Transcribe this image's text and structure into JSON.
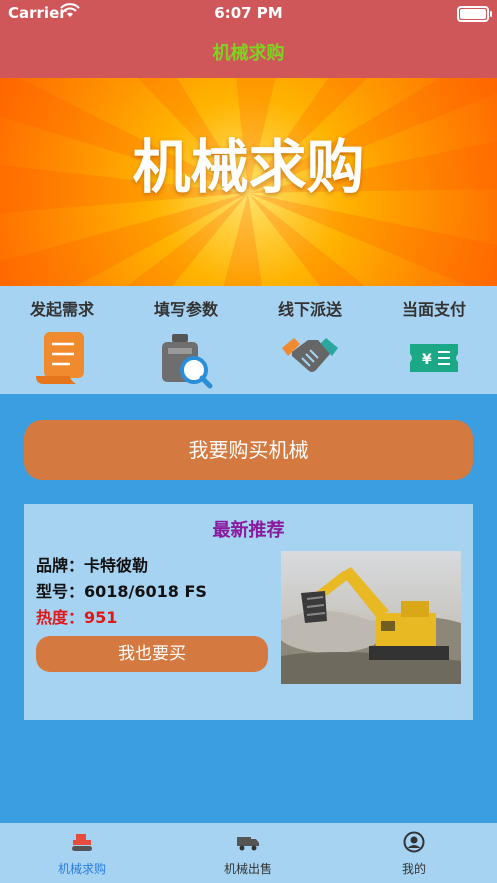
{
  "status_bar": {
    "carrier": "Carrier",
    "time": "6:07 PM"
  },
  "navbar": {
    "title": "机械求购"
  },
  "banner": {
    "title": "机械求购"
  },
  "features": [
    {
      "label": "发起需求",
      "icon": "scroll-document-icon"
    },
    {
      "label": "填写参数",
      "icon": "search-parameter-icon"
    },
    {
      "label": "线下派送",
      "icon": "handshake-icon"
    },
    {
      "label": "当面支付",
      "icon": "yuan-ticket-icon"
    }
  ],
  "buy_button": {
    "label": "我要购买机械"
  },
  "recommend": {
    "title": "最新推荐",
    "brand": "品牌：卡特彼勒",
    "model": "型号：6018/6018 FS",
    "hot": "热度：951",
    "button": "我也要买",
    "image": "excavator-photo"
  },
  "tabbar": [
    {
      "label": "机械求购",
      "icon": "crawler-machine-icon",
      "active": true
    },
    {
      "label": "机械出售",
      "icon": "truck-icon",
      "active": false
    },
    {
      "label": "我的",
      "icon": "user-circle-icon",
      "active": false
    }
  ],
  "colors": {
    "navbar": "#cf5759",
    "nav_title": "#7ed321",
    "accent_button": "#d47a40",
    "panel": "#a6d3f2",
    "background": "#3a9ee0",
    "recommend_title": "#8a1a9e",
    "hot_text": "#e01818",
    "tab_active": "#2a7de1"
  }
}
